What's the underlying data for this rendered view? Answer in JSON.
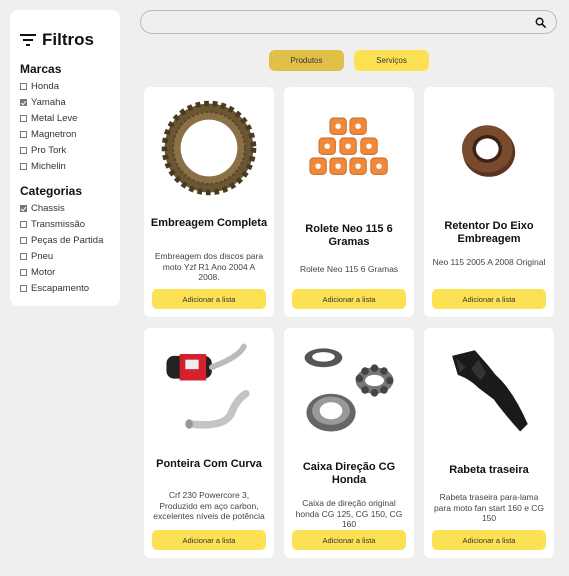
{
  "filters": {
    "title": "Filtros",
    "brands_title": "Marcas",
    "brands": [
      {
        "label": "Honda",
        "checked": false
      },
      {
        "label": "Yamaha",
        "checked": true
      },
      {
        "label": "Metal Leve",
        "checked": false
      },
      {
        "label": "Magnetron",
        "checked": false
      },
      {
        "label": "Pro Tork",
        "checked": false
      },
      {
        "label": "Michelin",
        "checked": false
      }
    ],
    "categories_title": "Categorias",
    "categories": [
      {
        "label": "Chassis",
        "checked": true
      },
      {
        "label": "Transmissão",
        "checked": false
      },
      {
        "label": "Peças de Partida",
        "checked": false
      },
      {
        "label": "Pneu",
        "checked": false
      },
      {
        "label": "Motor",
        "checked": false
      },
      {
        "label": "Escapamento",
        "checked": false
      }
    ]
  },
  "search": {
    "value": "",
    "placeholder": ""
  },
  "tabs": [
    {
      "label": "Produtos",
      "active": true
    },
    {
      "label": "Serviços",
      "active": false
    }
  ],
  "products": [
    {
      "title": "Embreagem Completa",
      "desc": "Embreagem dos discos para moto Yzf R1 Ano 2004 A 2008.",
      "button": "Adicionar a lista",
      "icon": "clutch-disc-icon"
    },
    {
      "title": "Rolete Neo 115 6 Gramas",
      "desc": "Rolete Neo 115 6 Gramas",
      "button": "Adicionar a lista",
      "icon": "rollers-icon"
    },
    {
      "title": "Retentor Do Eixo Embreagem",
      "desc": "Neo 115 2005 A 2008 Original",
      "button": "Adicionar a lista",
      "icon": "oil-seal-icon"
    },
    {
      "title": "Ponteira Com Curva",
      "desc": "Crf 230 Powercore 3, Produzido em aço carbon, excelentes níveis de potência",
      "button": "Adicionar a lista",
      "icon": "exhaust-icon"
    },
    {
      "title": "Caixa Direção CG Honda",
      "desc": "Caixa de direção original honda CG 125, CG 150, CG 160",
      "button": "Adicionar a lista",
      "icon": "bearing-icon"
    },
    {
      "title": "Rabeta traseira",
      "desc": "Rabeta traseira para-lama para moto fan start 160 e CG 150",
      "button": "Adicionar a lista",
      "icon": "rear-fender-icon"
    }
  ]
}
